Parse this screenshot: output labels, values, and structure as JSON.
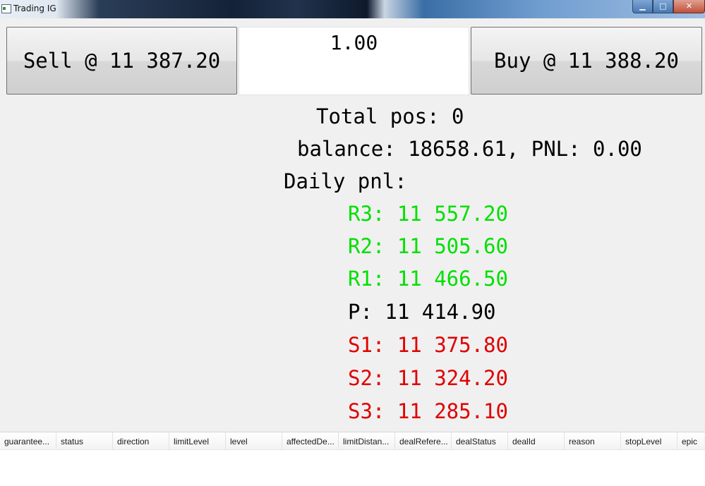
{
  "window": {
    "title": "Trading IG",
    "controls": {
      "minimize": "▁",
      "maximize": "□",
      "close": "✕"
    }
  },
  "trade": {
    "sell_label": "Sell @ 11 387.20",
    "quantity": "1.00",
    "buy_label": "Buy @ 11 388.20"
  },
  "info": {
    "total_pos": "Total pos: 0",
    "balance": "balance: 18658.61, PNL: 0.00",
    "daily_pnl": "Daily pnl:"
  },
  "levels": {
    "r3": "R3: 11 557.20",
    "r2": "R2: 11 505.60",
    "r1": "R1: 11 466.50",
    "p": "P: 11 414.90",
    "s1": "S1: 11 375.80",
    "s2": "S2: 11 324.20",
    "s3": "S3: 11 285.10"
  },
  "colors": {
    "resistance": "#00e000",
    "pivot": "#000000",
    "support": "#e00000"
  },
  "table": {
    "columns": [
      "guarantee...",
      "status",
      "direction",
      "limitLevel",
      "level",
      "affectedDe...",
      "limitDistan...",
      "dealRefere...",
      "dealStatus",
      "dealId",
      "reason",
      "stopLevel",
      "epic"
    ]
  }
}
